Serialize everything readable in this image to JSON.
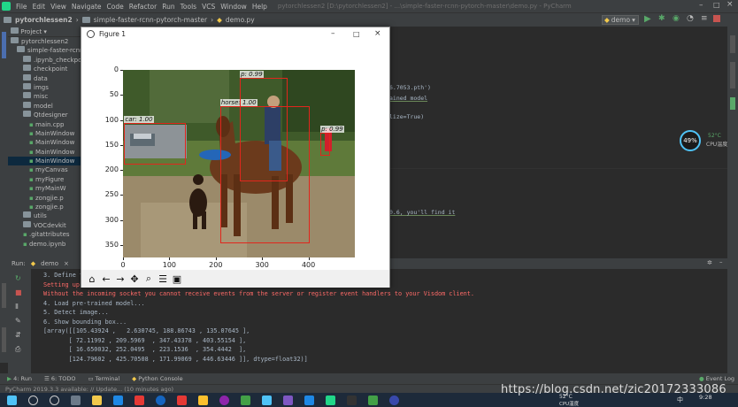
{
  "menubar": {
    "items": [
      "File",
      "Edit",
      "View",
      "Navigate",
      "Code",
      "Refactor",
      "Run",
      "Tools",
      "VCS",
      "Window",
      "Help"
    ],
    "title": "pytorchlessen2 [D:\\pytorchlessen2] - ...\\simple-faster-rcnn-pytorch-master\\demo.py - PyCharm"
  },
  "navbar": {
    "crumbs": [
      "pytorchlessen2",
      "simple-faster-rcnn-pytorch-master",
      "demo.py"
    ],
    "run_config": "demo"
  },
  "project": {
    "header": "Project",
    "items": [
      {
        "label": "pytorchlessen2",
        "indent": 0,
        "kind": "folder"
      },
      {
        "label": "simple-faster-rcnn",
        "indent": 1,
        "kind": "folder"
      },
      {
        "label": ".ipynb_checkpoints",
        "indent": 2,
        "kind": "folder"
      },
      {
        "label": "checkpoint",
        "indent": 2,
        "kind": "folder"
      },
      {
        "label": "data",
        "indent": 2,
        "kind": "folder"
      },
      {
        "label": "imgs",
        "indent": 2,
        "kind": "folder"
      },
      {
        "label": "misc",
        "indent": 2,
        "kind": "folder"
      },
      {
        "label": "model",
        "indent": 2,
        "kind": "folder"
      },
      {
        "label": "Qtdesigner",
        "indent": 2,
        "kind": "folder"
      },
      {
        "label": "main.cpp",
        "indent": 3,
        "kind": "file"
      },
      {
        "label": "MainWindow",
        "indent": 3,
        "kind": "file"
      },
      {
        "label": "MainWindow",
        "indent": 3,
        "kind": "file"
      },
      {
        "label": "MainWindow",
        "indent": 3,
        "kind": "file"
      },
      {
        "label": "MainWindow",
        "indent": 3,
        "kind": "file"
      },
      {
        "label": "myCanvas",
        "indent": 3,
        "kind": "file"
      },
      {
        "label": "myFigure",
        "indent": 3,
        "kind": "file"
      },
      {
        "label": "myMainW",
        "indent": 3,
        "kind": "file"
      },
      {
        "label": "zongjie.p",
        "indent": 3,
        "kind": "file"
      },
      {
        "label": "zongjie.p",
        "indent": 3,
        "kind": "file"
      },
      {
        "label": "utils",
        "indent": 2,
        "kind": "folder"
      },
      {
        "label": "VOCdevkit",
        "indent": 2,
        "kind": "folder"
      },
      {
        "label": ".gitattributes",
        "indent": 2,
        "kind": "file"
      },
      {
        "label": "demo.ipynb",
        "indent": 2,
        "kind": "file"
      }
    ]
  },
  "editor": {
    "snippets": [
      {
        "text": "6.7053.pth')"
      },
      {
        "text": "ained model"
      },
      {
        "text": "lize=True)"
      },
      {
        "text": "0.6, you'll find it"
      }
    ]
  },
  "figure": {
    "title": "Figure 1",
    "boxes": [
      {
        "label": "car: 1.00"
      },
      {
        "label": "horse: 1.00"
      },
      {
        "label": "p: 0.99"
      },
      {
        "label": "p: 0.99"
      }
    ]
  },
  "chart_data": {
    "type": "image",
    "xlim": [
      0,
      500
    ],
    "ylim": [
      375,
      0
    ],
    "xticks": [
      0,
      100,
      200,
      300,
      400
    ],
    "yticks": [
      0,
      50,
      100,
      150,
      200,
      250,
      300,
      350
    ]
  },
  "run": {
    "tab_label": "Run:",
    "config": "demo",
    "lines": [
      {
        "text": "3. Define t",
        "err": false
      },
      {
        "text": "Setting up",
        "err": true
      },
      {
        "text": "Without the incoming socket you cannot receive events from the server or register event handlers to your Visdom client.",
        "err": true
      },
      {
        "text": "4. Load pre-trained model...",
        "err": false
      },
      {
        "text": "5. Detect image...",
        "err": false
      },
      {
        "text": "6. Show bounding box...",
        "err": false
      },
      {
        "text": "[array([[105.43924 ,   2.630745, 188.86743 , 135.07645 ],",
        "err": false
      },
      {
        "text": "       [ 72.11992 , 209.5969  , 347.43378 , 403.55154 ],",
        "err": false
      },
      {
        "text": "       [ 16.650032, 252.0495  , 223.1536  , 354.4442  ],",
        "err": false
      },
      {
        "text": "       [124.79602 , 425.70508 , 171.99069 , 446.63446 ]], dtype=float32)]",
        "err": false
      }
    ]
  },
  "bottom_tabs": [
    "4: Run",
    "6: TODO",
    "Terminal",
    "Python Console"
  ],
  "event_log": "Event Log",
  "status": "PyCharm 2019.3.3 available: // Update... (10 minutes ago)",
  "cpu": {
    "percent": "49%",
    "temp": "52°C",
    "label": "CPU温度"
  },
  "watermark": "https://blog.csdn.net/zic20172333086",
  "taskbar": {
    "time": "9:28",
    "weather": "52°C",
    "cpu_label": "CPU温度",
    "ime": "中"
  }
}
